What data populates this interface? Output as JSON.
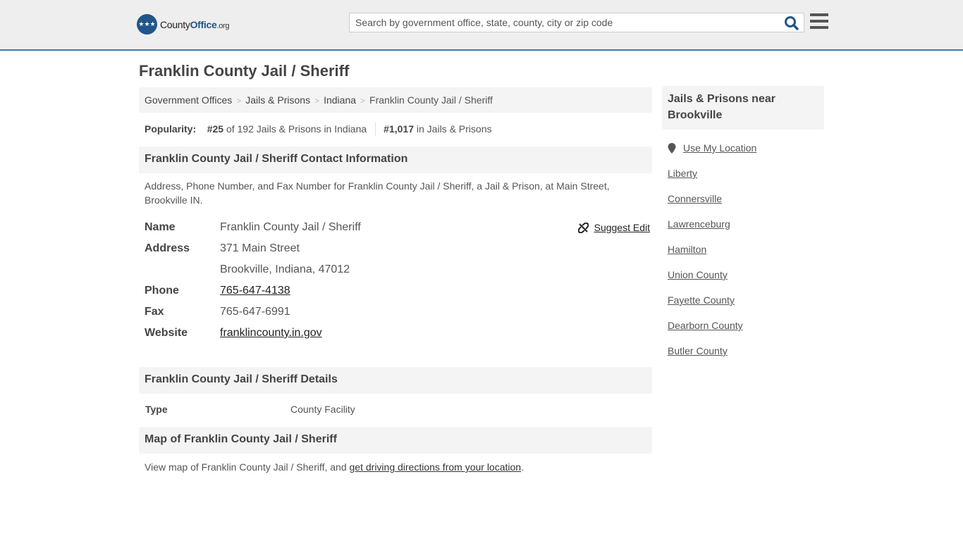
{
  "header": {
    "logo": {
      "county": "County",
      "office": "Office",
      "org": ".org"
    },
    "search_placeholder": "Search by government office, state, county, city or zip code",
    "search_value": ""
  },
  "page_title": "Franklin County Jail / Sheriff",
  "breadcrumb": [
    "Government Offices",
    "Jails & Prisons",
    "Indiana",
    "Franklin County Jail / Sheriff"
  ],
  "breadcrumb_sep": ">",
  "popularity": {
    "label": "Popularity:",
    "state_rank": "#25",
    "state_rank_text": "of 192 Jails & Prisons in Indiana",
    "national_rank": "#1,017",
    "national_rank_text": "in Jails & Prisons"
  },
  "contact": {
    "heading": "Franklin County Jail / Sheriff Contact Information",
    "description": "Address, Phone Number, and Fax Number for Franklin County Jail / Sheriff, a Jail & Prison, at Main Street, Brookville IN.",
    "suggest_edit": "Suggest Edit",
    "fields": {
      "name_label": "Name",
      "name": "Franklin County Jail / Sheriff",
      "address_label": "Address",
      "address_line1": "371 Main Street",
      "address_line2": "Brookville, Indiana, 47012",
      "phone_label": "Phone",
      "phone": "765-647-4138",
      "fax_label": "Fax",
      "fax": "765-647-6991",
      "website_label": "Website",
      "website": "franklincounty.in.gov"
    }
  },
  "details": {
    "heading": "Franklin County Jail / Sheriff Details",
    "type_label": "Type",
    "type_value": "County Facility"
  },
  "map": {
    "heading": "Map of Franklin County Jail / Sheriff",
    "text": "View map of Franklin County Jail / Sheriff, and ",
    "link": "get driving directions from your location",
    "suffix": "."
  },
  "sidebar": {
    "heading": "Jails & Prisons near Brookville",
    "use_location": "Use My Location",
    "items": [
      "Liberty",
      "Connersville",
      "Lawrenceburg",
      "Hamilton",
      "Union County",
      "Fayette County",
      "Dearborn County",
      "Butler County"
    ]
  },
  "colors": {
    "brand": "#20558a",
    "header_border": "#3a7db5",
    "panel_bg": "#f4f4f4"
  }
}
